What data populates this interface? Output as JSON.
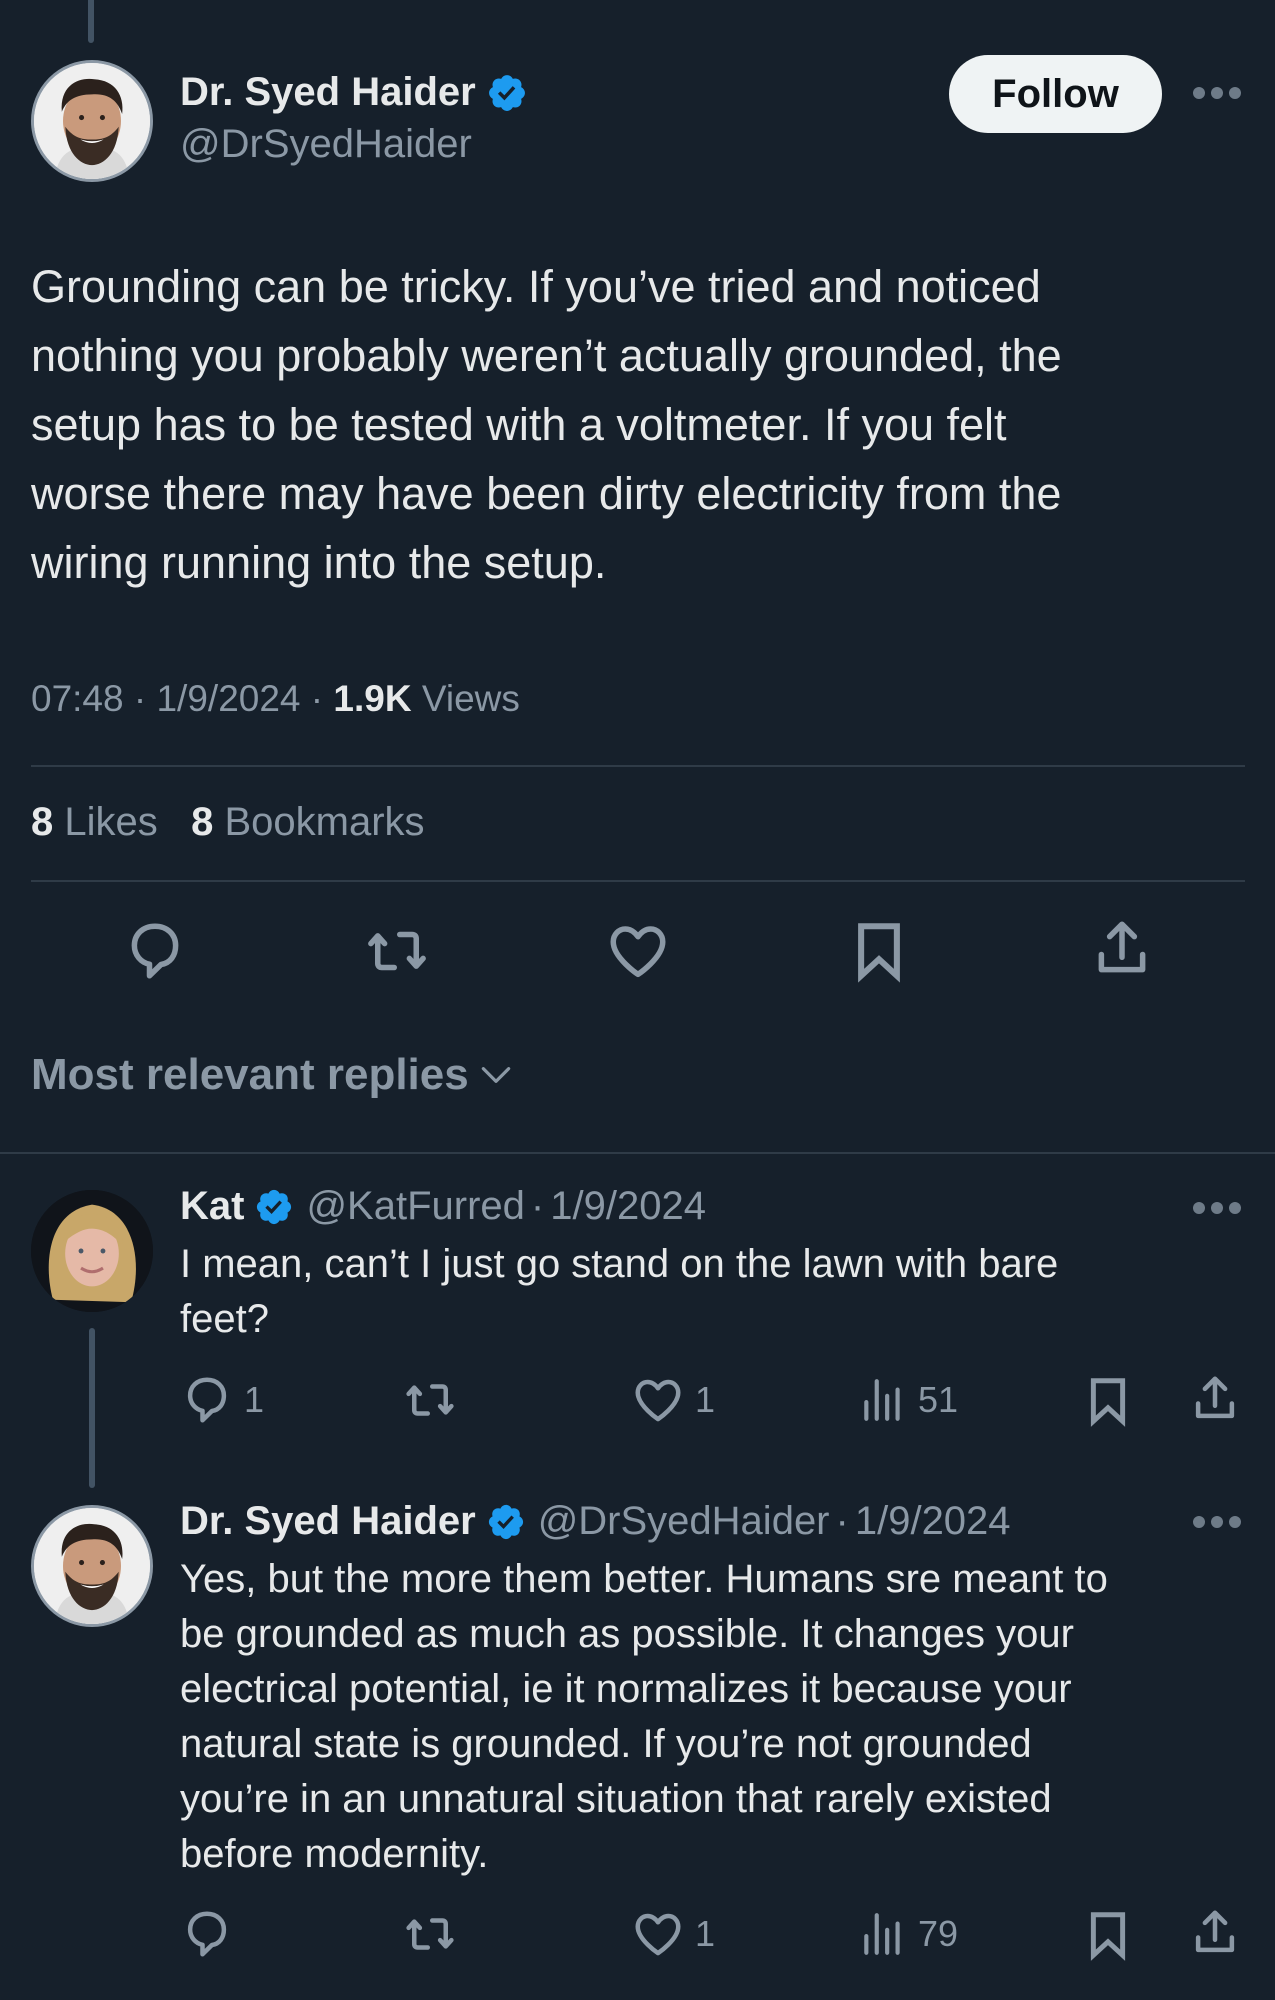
{
  "main_tweet": {
    "author": {
      "name": "Dr. Syed Haider",
      "handle": "@DrSyedHaider",
      "verified": true,
      "avatar": "man-avatar"
    },
    "follow_label": "Follow",
    "more_icon": "more-horizontal-icon",
    "text": "Grounding can be tricky. If you’ve tried and noticed\nnothing you probably weren’t actually grounded, the\nsetup has to be tested with a voltmeter. If you felt\nworse there may have been dirty electricity from the\nwiring running into the setup.",
    "time": "07:48",
    "date": "1/9/2024",
    "separator": "·",
    "views_count": "1.9K",
    "views_label": "Views",
    "likes_count": "8",
    "likes_label": "Likes",
    "bookmarks_count": "8",
    "bookmarks_label": "Bookmarks",
    "actions": [
      {
        "icon": "reply-icon"
      },
      {
        "icon": "repost-icon"
      },
      {
        "icon": "like-icon"
      },
      {
        "icon": "bookmark-icon"
      },
      {
        "icon": "share-icon"
      }
    ]
  },
  "replies_sort": {
    "label": "Most relevant replies",
    "icon": "chevron-down-icon"
  },
  "replies": [
    {
      "name": "Kat",
      "handle": "@KatFurred",
      "date": "1/9/2024",
      "separator": "·",
      "verified": true,
      "avatar": "woman-avatar",
      "text": "I mean, can’t I just go stand on the lawn with bare\nfeet?",
      "reply_count": "1",
      "repost_count": "",
      "like_count": "1",
      "view_count": "51"
    },
    {
      "name": "Dr. Syed Haider",
      "handle": "@DrSyedHaider",
      "date": "1/9/2024",
      "separator": "·",
      "verified": true,
      "avatar": "man-avatar",
      "text": "Yes, but the more them better. Humans sre meant to\nbe grounded as much as possible. It changes your\nelectrical potential, ie it normalizes it because your\nnatural state is grounded. If you’re not grounded\nyou’re in an unnatural situation that rarely existed\nbefore modernity.",
      "reply_count": "",
      "repost_count": "",
      "like_count": "1",
      "view_count": "79"
    }
  ],
  "colors": {
    "background": "#16202b",
    "text_primary": "#e7e9ea",
    "text_secondary": "#8b98a5",
    "verified_blue": "#1d9bf0",
    "divider": "#2f3b47",
    "follow_bg": "#eff3f4",
    "thread_line": "#425364"
  }
}
